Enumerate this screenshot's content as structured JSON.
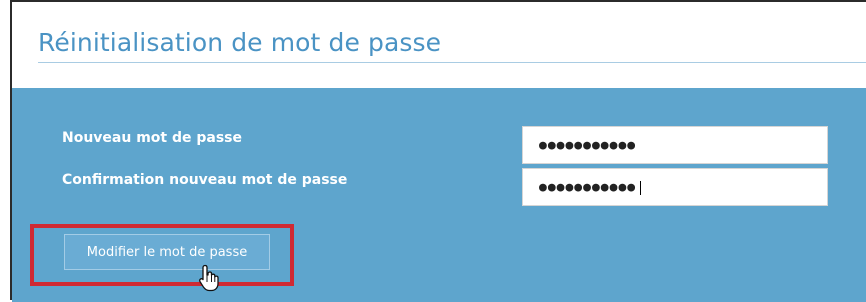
{
  "form": {
    "title": "Réinitialisation de mot de passe",
    "new_password_label": "Nouveau mot de passe",
    "confirm_password_label": "Confirmation nouveau mot de passe",
    "new_password_value": "●●●●●●●●●●●",
    "confirm_password_value": "●●●●●●●●●●●",
    "submit_label": "Modifier le mot de passe"
  },
  "colors": {
    "title": "#4a93c4",
    "panel_background": "#5ea5cd",
    "highlight_box": "#cf2a33"
  },
  "icons": {
    "cursor": "hand-pointer-icon"
  }
}
